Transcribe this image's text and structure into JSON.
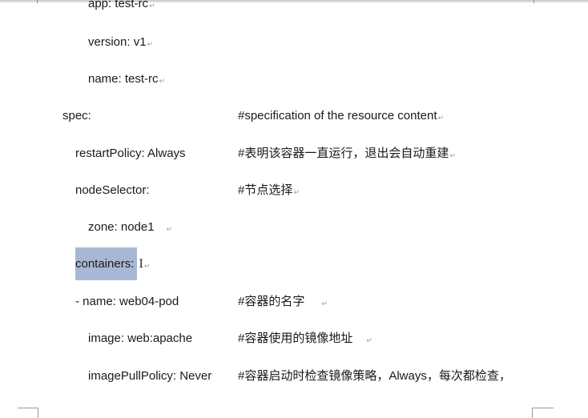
{
  "document": {
    "return_mark": "↵",
    "lines": [
      {
        "key": "app: test-rc",
        "comment": ""
      },
      {
        "key": "version: v1",
        "comment": ""
      },
      {
        "key": "name: test-rc",
        "comment": ""
      },
      {
        "key": "spec:",
        "comment": "#specification of the resource content"
      },
      {
        "key": "restartPolicy: Always",
        "comment": "#表明该容器一直运行，退出会自动重建"
      },
      {
        "key": "nodeSelector:",
        "comment": "#节点选择"
      },
      {
        "key": "zone: node1",
        "comment": ""
      },
      {
        "key": "containers:",
        "comment": ""
      },
      {
        "key": "- name: web04-pod",
        "comment": "#容器的名字"
      },
      {
        "key": "image: web:apache",
        "comment": "#容器使用的镜像地址"
      },
      {
        "key": "imagePullPolicy: Never",
        "comment": "#容器启动时检查镜像策略，Always，每次都检查，"
      }
    ]
  }
}
